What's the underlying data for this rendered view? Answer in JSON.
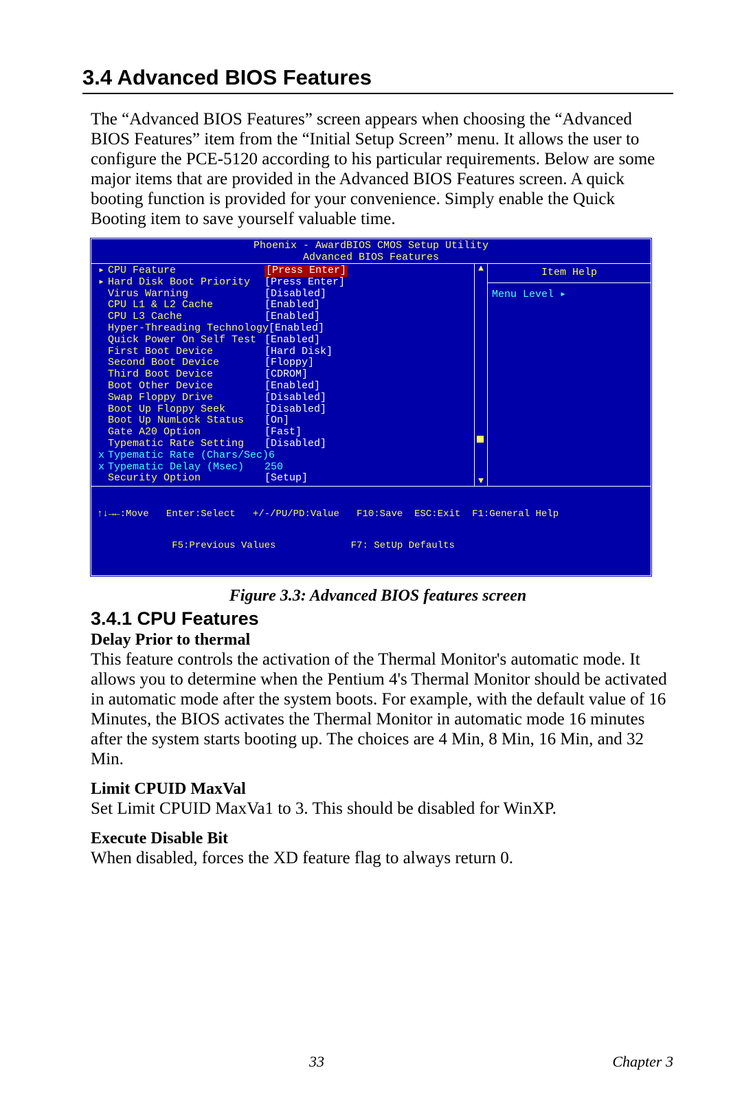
{
  "section": {
    "number_title": "3.4  Advanced BIOS Features",
    "intro": "The “Advanced BIOS Features” screen appears when choosing the “Advanced BIOS Features” item from the “Initial Setup Screen” menu. It allows the user to configure the PCE-5120 according to his particular requirements. Below are some major items that are provided in the Advanced BIOS Features screen. A quick booting function is provided for your convenience. Simply enable the Quick Booting item to save yourself valuable time."
  },
  "bios": {
    "title_line1": "Phoenix - AwardBIOS CMOS Setup Utility",
    "title_line2": "Advanced BIOS Features",
    "help_title": "Item Help",
    "menu_level": "Menu Level    ▸",
    "rows": [
      {
        "marker": "▸",
        "label": "CPU Feature",
        "value": "[Press Enter]",
        "selected": true
      },
      {
        "marker": "▸",
        "label": "Hard Disk Boot Priority",
        "value": "[Press Enter]"
      },
      {
        "marker": "",
        "label": "Virus Warning",
        "value": "[Disabled]"
      },
      {
        "marker": "",
        "label": "CPU L1 & L2 Cache",
        "value": "[Enabled]"
      },
      {
        "marker": "",
        "label": "CPU L3 Cache",
        "value": "[Enabled]"
      },
      {
        "marker": "",
        "label": "Hyper-Threading Technology",
        "value": "[Enabled]"
      },
      {
        "marker": "",
        "label": "Quick Power On Self Test",
        "value": "[Enabled]"
      },
      {
        "marker": "",
        "label": "First Boot Device",
        "value": "[Hard Disk]"
      },
      {
        "marker": "",
        "label": "Second Boot Device",
        "value": "[Floppy]"
      },
      {
        "marker": "",
        "label": "Third Boot Device",
        "value": "[CDROM]"
      },
      {
        "marker": "",
        "label": "Boot Other Device",
        "value": "[Enabled]"
      },
      {
        "marker": "",
        "label": "Swap Floppy Drive",
        "value": "[Disabled]"
      },
      {
        "marker": "",
        "label": "Boot Up Floppy Seek",
        "value": "[Disabled]"
      },
      {
        "marker": "",
        "label": "Boot Up NumLock Status",
        "value": "[On]"
      },
      {
        "marker": "",
        "label": "Gate A20 Option",
        "value": "[Fast]"
      },
      {
        "marker": "",
        "label": "Typematic Rate Setting",
        "value": "[Disabled]"
      },
      {
        "marker": "x",
        "label": "Typematic Rate (Chars/Sec)",
        "value": "6",
        "disabled": true
      },
      {
        "marker": "x",
        "label": "Typematic Delay (Msec)",
        "value": "250",
        "disabled": true
      },
      {
        "marker": "",
        "label": "Security Option",
        "value": "[Setup]"
      }
    ],
    "footer_line1": "↑↓→←:Move   Enter:Select   +/-/PU/PD:Value   F10:Save  ESC:Exit  F1:General Help",
    "footer_line2": "             F5:Previous Values             F7: SetUp Defaults"
  },
  "figure_caption": "Figure 3.3: Advanced BIOS features screen",
  "subsection": {
    "title": "3.4.1 CPU Features",
    "items": [
      {
        "heading": "Delay Prior to thermal",
        "body": "This feature controls the activation of the Thermal Monitor's automatic mode. It allows you to determine when the Pentium 4's Thermal Monitor should be activated in automatic mode after the system boots. For example, with the default value of 16 Minutes, the BIOS activates the Thermal Monitor in automatic mode 16 minutes after the system starts booting up. The choices are 4 Min, 8 Min, 16 Min, and 32 Min."
      },
      {
        "heading": "Limit CPUID MaxVal",
        "body": "Set Limit CPUID MaxVa1 to 3. This should be disabled for WinXP."
      },
      {
        "heading": "Execute Disable Bit",
        "body": "When disabled, forces the XD feature flag to always return 0."
      }
    ]
  },
  "footer": {
    "page_number": "33",
    "chapter": "Chapter 3"
  }
}
